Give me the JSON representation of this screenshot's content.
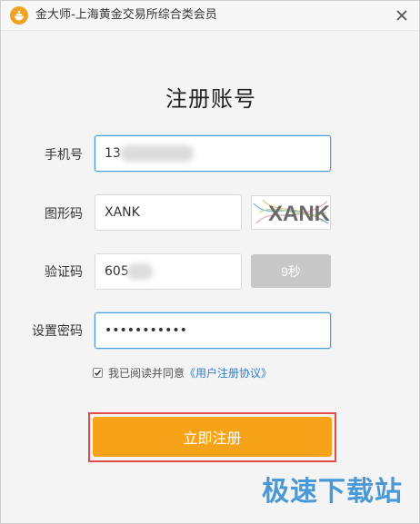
{
  "window": {
    "title": "金大师-上海黄金交易所综合类会员",
    "close_label": "×"
  },
  "page": {
    "title": "注册账号"
  },
  "form": {
    "phone": {
      "label": "手机号",
      "value": "13"
    },
    "captcha": {
      "label": "图形码",
      "value": "XANK",
      "image_text": "XANK"
    },
    "sms_code": {
      "label": "验证码",
      "value": "605",
      "button_label": "9秒"
    },
    "password": {
      "label": "设置密码",
      "value": "•••••••••••"
    }
  },
  "agreement": {
    "prefix": "我已阅读并同意",
    "link": "《用户注册协议》",
    "checked": true
  },
  "register_button": {
    "label": "立即注册"
  },
  "watermark": {
    "text": "极速下载站"
  },
  "colors": {
    "accent": "#f7a31a",
    "link": "#2d7fd6",
    "focus": "#4a9edb",
    "highlight": "#e24c4c"
  }
}
